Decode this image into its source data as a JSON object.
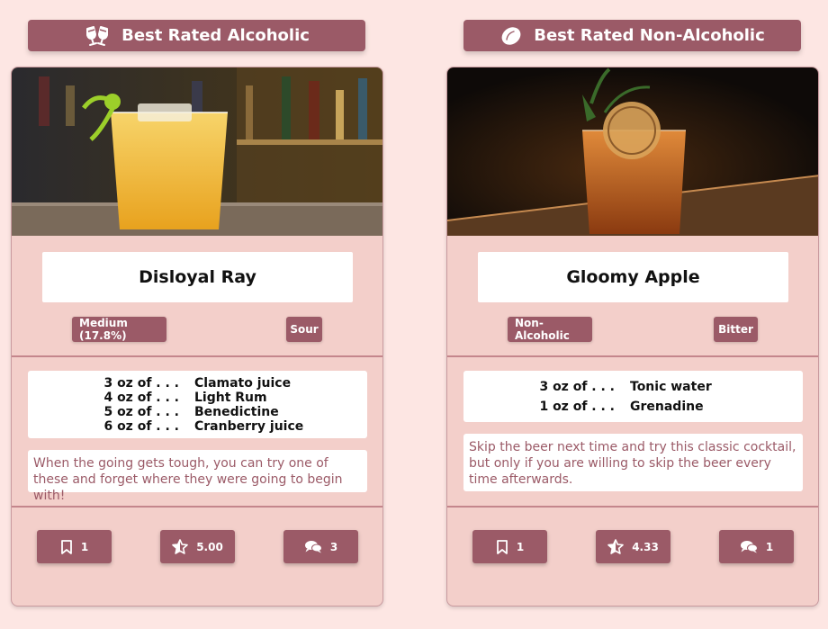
{
  "left": {
    "header": {
      "label": "Best Rated Alcoholic",
      "icon": "champagne-glasses-icon"
    },
    "card": {
      "title": "Disloyal Ray",
      "tags": [
        "Medium (17.8%)",
        "Sour"
      ],
      "ingredients": [
        {
          "amount": "3 oz of . . .",
          "name": "Clamato juice"
        },
        {
          "amount": "4 oz of . . .",
          "name": "Light Rum"
        },
        {
          "amount": "5 oz of . . .",
          "name": "Benedictine"
        },
        {
          "amount": "6 oz of . . .",
          "name": "Cranberry juice"
        }
      ],
      "description": "When the going gets tough, you can try one of these and forget where they were going to begin with!",
      "actions": {
        "bookmarks": "1",
        "rating": "5.00",
        "comments": "3"
      }
    }
  },
  "right": {
    "header": {
      "label": "Best Rated Non-Alcoholic",
      "icon": "lemon-icon"
    },
    "card": {
      "title": "Gloomy Apple",
      "tags": [
        "Non-Alcoholic",
        "Bitter"
      ],
      "ingredients": [
        {
          "amount": "3 oz of . . .",
          "name": "Tonic water"
        },
        {
          "amount": "1 oz of . . .",
          "name": "Grenadine"
        }
      ],
      "description": "Skip the beer next time and try this classic cocktail, but only if you are willing to skip the beer every time afterwards.",
      "actions": {
        "bookmarks": "1",
        "rating": "4.33",
        "comments": "1"
      }
    }
  },
  "colors": {
    "background": "#fde6e3",
    "card": "#f3cfca",
    "accent": "#9b5a67",
    "divider": "#c4868c"
  }
}
